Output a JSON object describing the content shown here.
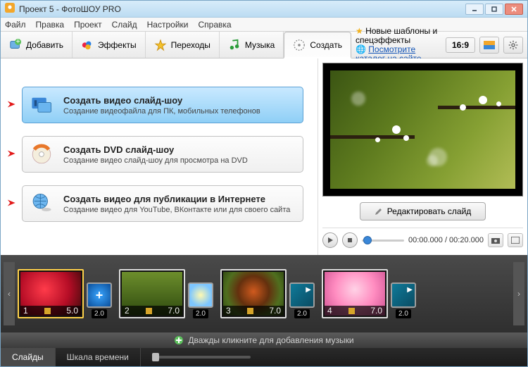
{
  "window": {
    "title": "Проект 5 - ФотоШОУ PRO"
  },
  "menu": {
    "file": "Файл",
    "edit": "Правка",
    "project": "Проект",
    "slide": "Слайд",
    "settings": "Настройки",
    "help": "Справка"
  },
  "toolbar": {
    "add": "Добавить",
    "effects": "Эффекты",
    "transitions": "Переходы",
    "music": "Музыка",
    "create": "Создать"
  },
  "promo": {
    "line1": "Новые шаблоны и спецэффекты",
    "line2": "Посмотрите каталог на сайте..."
  },
  "aspect": "16:9",
  "options": [
    {
      "title": "Создать видео слайд-шоу",
      "sub": "Создание видеофайла для ПК, мобильных телефонов"
    },
    {
      "title": "Создать DVD слайд-шоу",
      "sub": "Создание видео слайд-шоу для просмотра на DVD"
    },
    {
      "title": "Создать видео для публикации в Интернете",
      "sub": "Создание видео для YouTube, ВКонтакте или для своего сайта"
    }
  ],
  "preview": {
    "edit": "Редактировать слайд",
    "time": "00:00.000 / 00:20.000"
  },
  "timeline": {
    "slides": [
      {
        "n": "1",
        "dur": "5.0",
        "tdur": "2.0"
      },
      {
        "n": "2",
        "dur": "7.0",
        "tdur": "2.0"
      },
      {
        "n": "3",
        "dur": "7.0",
        "tdur": "2.0"
      },
      {
        "n": "4",
        "dur": "7.0",
        "tdur": "2.0"
      }
    ]
  },
  "musicHint": "Дважды кликните для добавления музыки",
  "bottomTabs": {
    "slides": "Слайды",
    "scale": "Шкала времени"
  }
}
